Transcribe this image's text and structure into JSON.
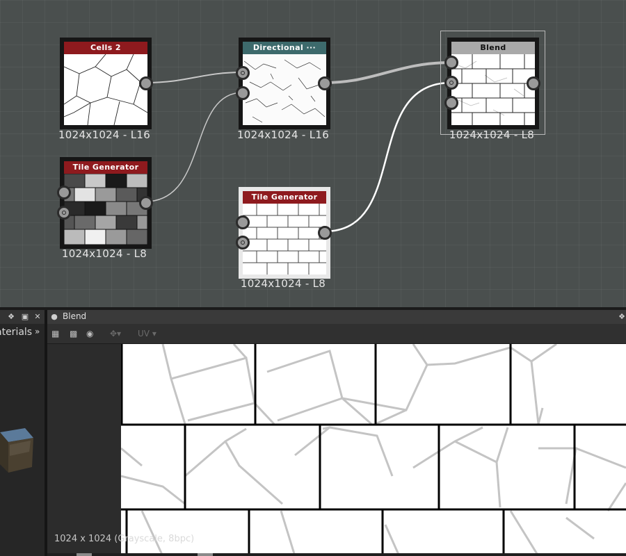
{
  "graph": {
    "nodes": {
      "cells2": {
        "title": "Cells 2",
        "color": "#8e1a1e",
        "resolution": "1024x1024 - L16"
      },
      "directional": {
        "title": "Directional ···",
        "color": "#3d6a6c",
        "resolution": "1024x1024 - L16"
      },
      "blend": {
        "title": "Blend",
        "color": "#a9a9a9",
        "resolution": "1024x1024 - L8"
      },
      "tile_gen_1": {
        "title": "Tile Generator",
        "color": "#8e1a1e",
        "resolution": "1024x1024 - L8"
      },
      "tile_gen_2": {
        "title": "Tile Generator",
        "color": "#8e1a1e",
        "resolution": "1024x1024 - L8"
      }
    }
  },
  "left_panel": {
    "materials_label": "aterials",
    "more_icon": "double-chevron-right-icon"
  },
  "viewer": {
    "title": "Blend",
    "toolbar": {
      "uv_label": "UV"
    },
    "info": "1024 x 1024 (Grayscale, 8bpc)"
  },
  "colors": {
    "graph_bg": "#4a4f4e",
    "panel_bg": "#2c2c2c",
    "node_red": "#8e1a1e",
    "node_teal": "#3d6a6c"
  }
}
